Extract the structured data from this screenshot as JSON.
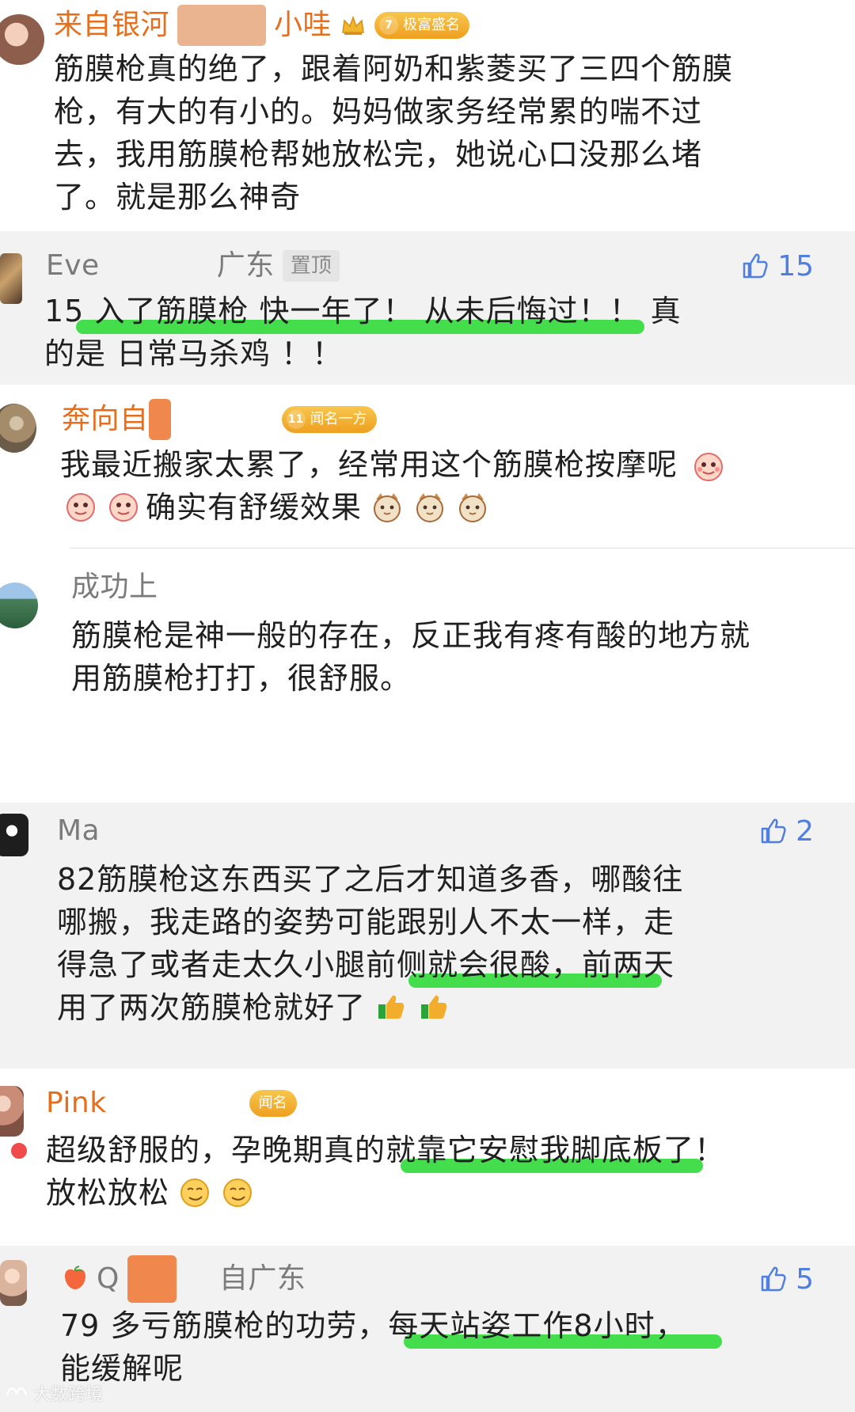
{
  "comments": [
    {
      "name_prefix": "来自银河",
      "name_suffix": "小哇",
      "badge_number": "7",
      "badge_text": "极富盛名",
      "text_lines": [
        "筋膜枪真的绝了，跟着阿奶和紫菱买了三四个筋膜",
        "枪，有大的有小的。妈妈做家务经常累的喘不过",
        "去，我用筋膜枪帮她放松完，她说心口没那么堵",
        "了。就是那么神奇"
      ]
    },
    {
      "name_prefix": "Eve",
      "location": "广东",
      "pin_label": "置顶",
      "like_count": "15",
      "text_lines": [
        "15 入了筋膜枪 快一年了！ 从未后悔过！！ 真",
        "的是 日常马杀鸡 ！！"
      ]
    },
    {
      "name_prefix": "奔向自",
      "badge_number": "11",
      "badge_text": "闻名一方",
      "text_lines": [
        "我最近搬家太累了，经常用这个筋膜枪按摩呢",
        "确实有舒缓效果"
      ]
    },
    {
      "name_prefix": "成功上",
      "text_lines": [
        "筋膜枪是神一般的存在，反正我有疼有酸的地方就",
        "用筋膜枪打打，很舒服。"
      ]
    },
    {
      "name_prefix": "Ma",
      "like_count": "2",
      "text_lines": [
        "82筋膜枪这东西买了之后才知道多香，哪酸往",
        "哪搬，我走路的姿势可能跟别人不太一样，走",
        "得急了或者走太久小腿前侧就会很酸，前两天",
        "用了两次筋膜枪就好了"
      ]
    },
    {
      "name_prefix": "Pink",
      "badge_text": "闻名",
      "text_lines": [
        "超级舒服的，孕晚期真的就靠它安慰我脚底板了！",
        "放松放松"
      ]
    },
    {
      "name_prefix": "Q",
      "location": "自广东",
      "like_count": "5",
      "text_lines": [
        "79 多亏筋膜枪的功劳，每天站姿工作8小时，",
        "能缓解呢"
      ]
    }
  ],
  "watermark": {
    "text": "大数跨境"
  }
}
